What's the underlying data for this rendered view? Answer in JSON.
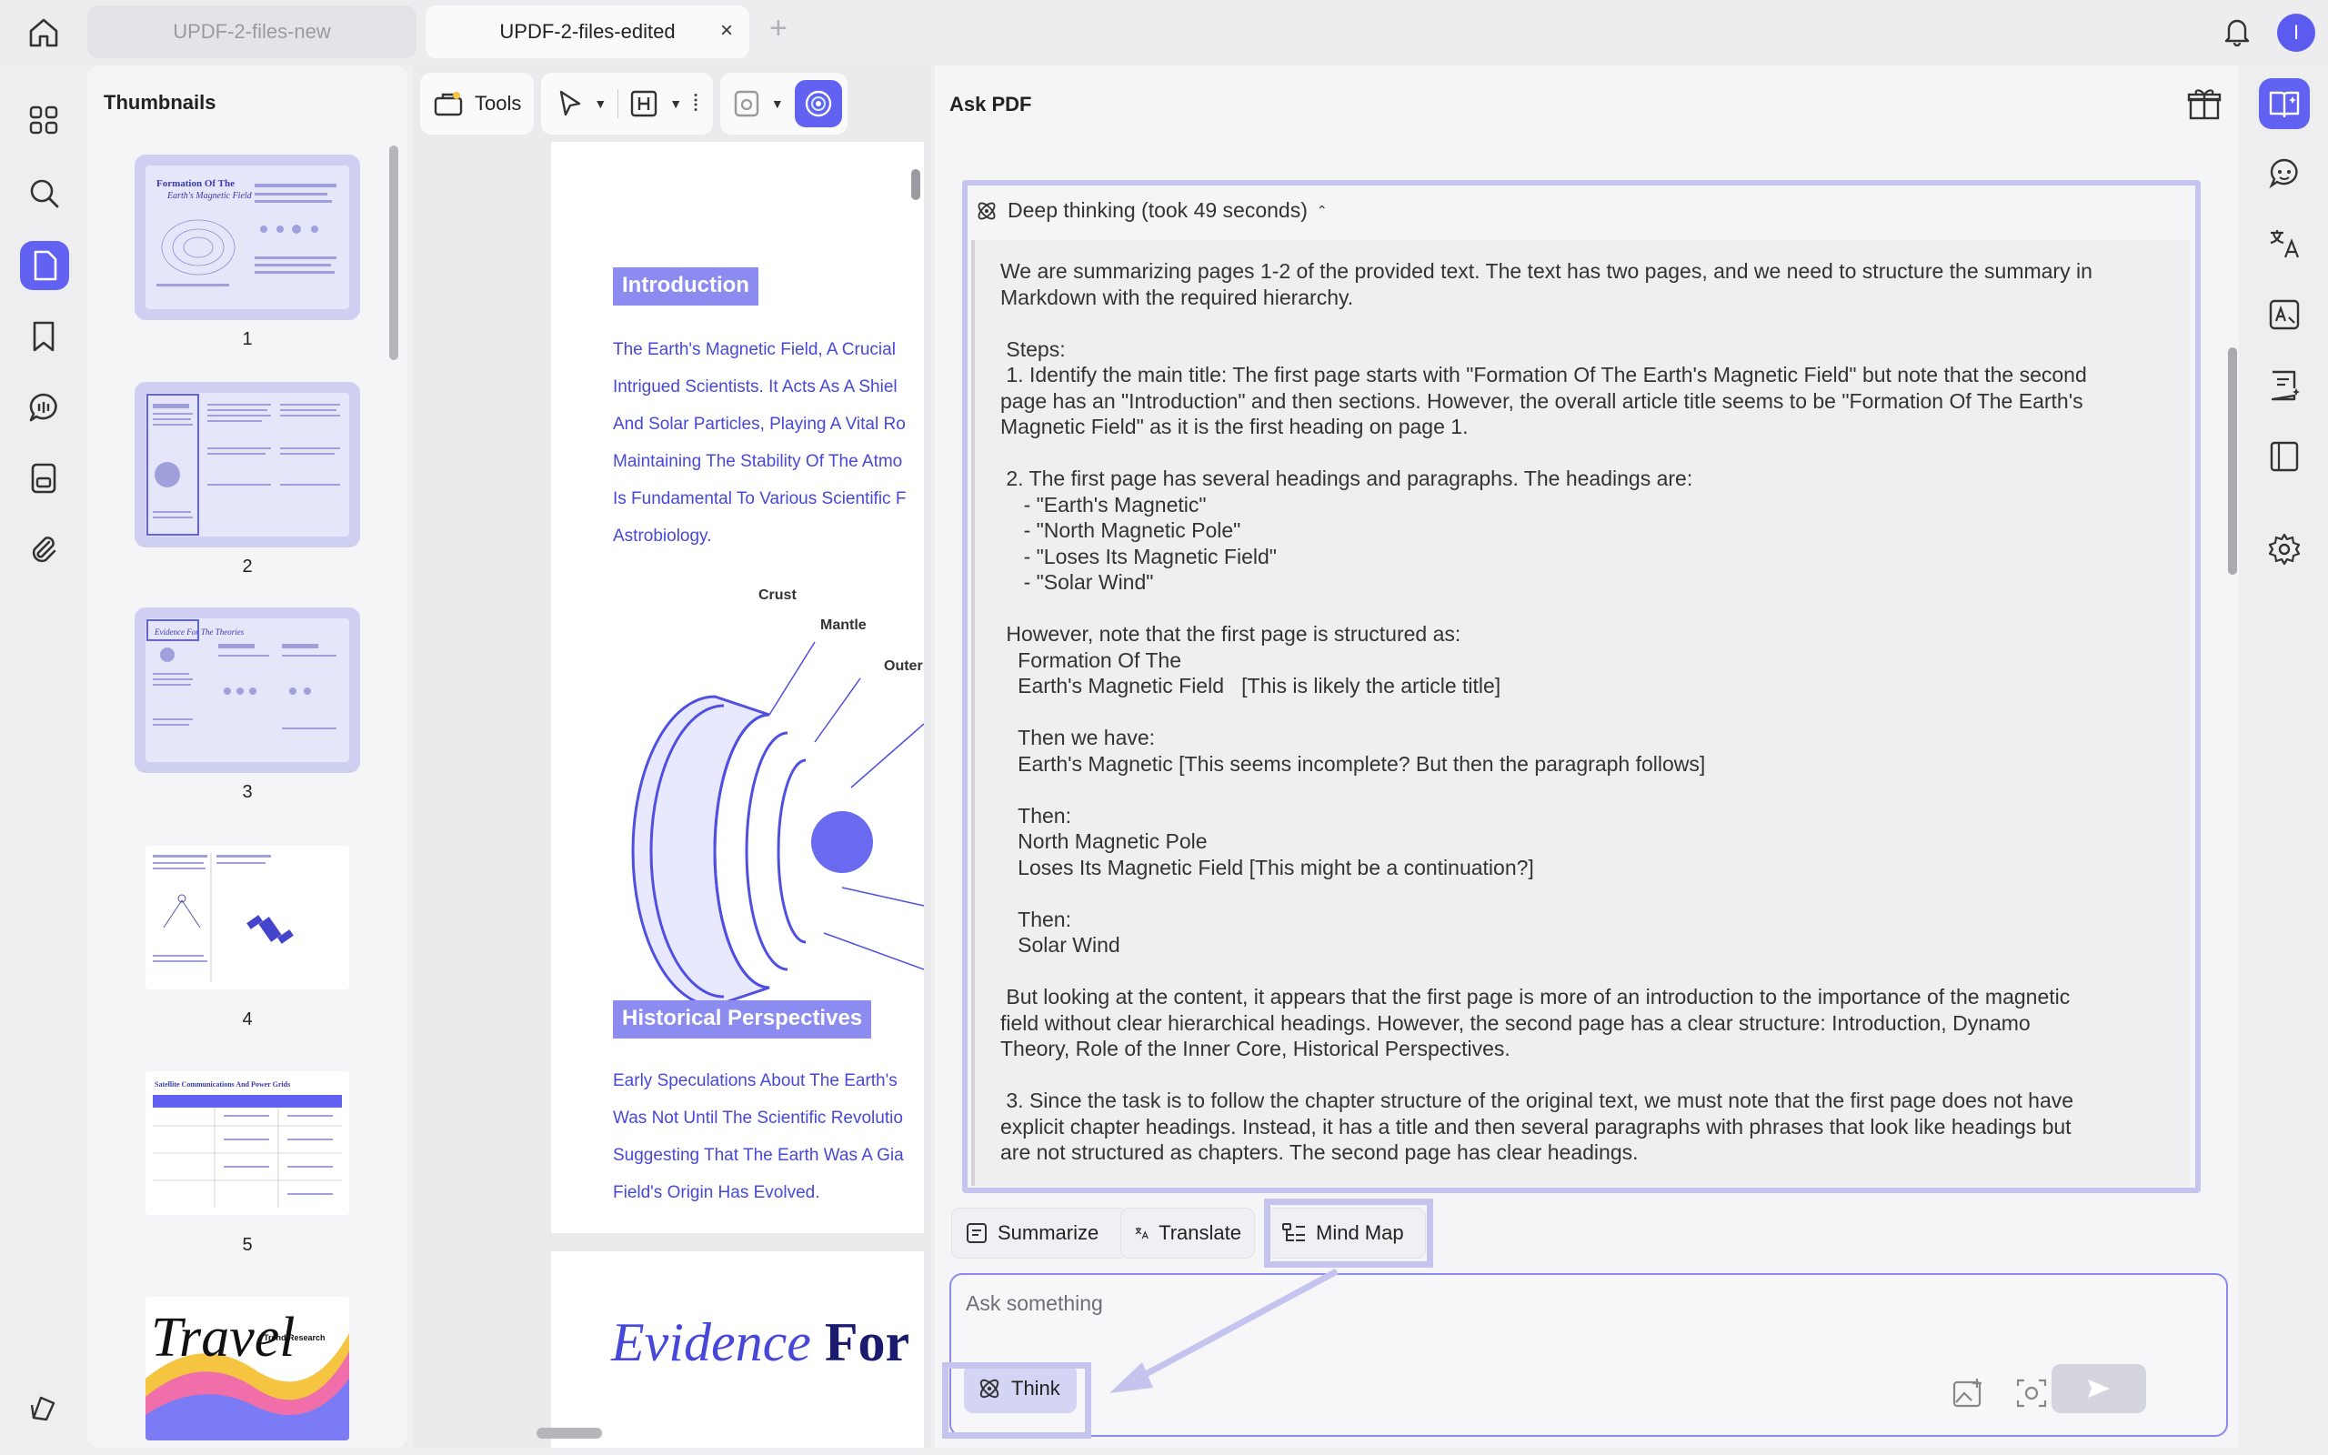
{
  "tabs": [
    {
      "label": "UPDF-2-files-new",
      "active": false
    },
    {
      "label": "UPDF-2-files-edited",
      "active": true
    }
  ],
  "tab_close": "×",
  "new_tab": "+",
  "avatar_initial": "I",
  "thumbnails": {
    "title": "Thumbnails",
    "pages": [
      "1",
      "2",
      "3",
      "4",
      "5"
    ],
    "thumb1": {
      "title_a": "Formation Of The",
      "title_b": "Earth's Magnetic Field"
    },
    "thumb3": {
      "title": "Evidence For The Theories"
    },
    "thumb5": {
      "title": "Satellite Communications And Power Grids"
    },
    "thumb6": {
      "title": "Travel",
      "subtitle": "Trend Research"
    }
  },
  "toolbar": {
    "tools_label": "Tools"
  },
  "document": {
    "intro_heading": "Introduction",
    "intro_lines": [
      "The Earth's Magnetic Field, A Crucial",
      "Intrigued Scientists. It Acts As A Shiel",
      "And Solar Particles, Playing A Vital Ro",
      "Maintaining The Stability Of The Atmo",
      "Is Fundamental To Various Scientific F",
      "Astrobiology."
    ],
    "diagram_labels": {
      "crust": "Crust",
      "mantle": "Mantle",
      "outer": "Outer"
    },
    "hist_heading": "Historical Perspectives",
    "hist_lines": [
      "Early Speculations About The Earth's",
      "Was Not Until The Scientific Revolutio",
      "Suggesting That The Earth Was A Gia",
      "Field's Origin Has Evolved."
    ],
    "page2_title_italic": "Evidence",
    "page2_title_bold": "For"
  },
  "ask_pdf": {
    "title": "Ask PDF",
    "deep_thinking_label": "Deep thinking (took 49 seconds)",
    "deep_thinking_text": "We are summarizing pages 1-2 of the provided text. The text has two pages, and we need to structure the summary in\nMarkdown with the required hierarchy.\n\n Steps:\n 1. Identify the main title: The first page starts with \"Formation Of The Earth's Magnetic Field\" but note that the second\npage has an \"Introduction\" and then sections. However, the overall article title seems to be \"Formation Of The Earth's\nMagnetic Field\" as it is the first heading on page 1.\n\n 2. The first page has several headings and paragraphs. The headings are:\n    - \"Earth's Magnetic\"\n    - \"North Magnetic Pole\"\n    - \"Loses Its Magnetic Field\"\n    - \"Solar Wind\"\n\n However, note that the first page is structured as:\n   Formation Of The\n   Earth's Magnetic Field   [This is likely the article title]\n\n   Then we have:\n   Earth's Magnetic [This seems incomplete? But then the paragraph follows]\n\n   Then:\n   North Magnetic Pole\n   Loses Its Magnetic Field [This might be a continuation?]\n\n   Then:\n   Solar Wind\n\n But looking at the content, it appears that the first page is more of an introduction to the importance of the magnetic\nfield without clear hierarchical headings. However, the second page has a clear structure: Introduction, Dynamo\nTheory, Role of the Inner Core, Historical Perspectives.\n\n 3. Since the task is to follow the chapter structure of the original text, we must note that the first page does not have\nexplicit chapter headings. Instead, it has a title and then several paragraphs with phrases that look like headings but\nare not structured as chapters. The second page has clear headings.",
    "actions": {
      "summarize": "Summarize",
      "translate": "Translate",
      "mind_map": "Mind Map"
    },
    "input_placeholder": "Ask something",
    "think_label": "Think"
  },
  "colors": {
    "accent": "#6161f2",
    "highlight": "#c4c4ee",
    "doc_text": "#4848d8",
    "heading_box": "#8b8bf0"
  },
  "icons": [
    "home-icon",
    "bell-icon",
    "grid-icon",
    "search-icon",
    "pages-icon",
    "bookmark-icon",
    "comment-icon",
    "stamp-icon",
    "attachment-icon",
    "layers-icon",
    "gift-icon",
    "chat-ai-icon",
    "translate-icon",
    "ocr-icon",
    "ai-doc-icon",
    "book-icon",
    "settings-icon"
  ]
}
